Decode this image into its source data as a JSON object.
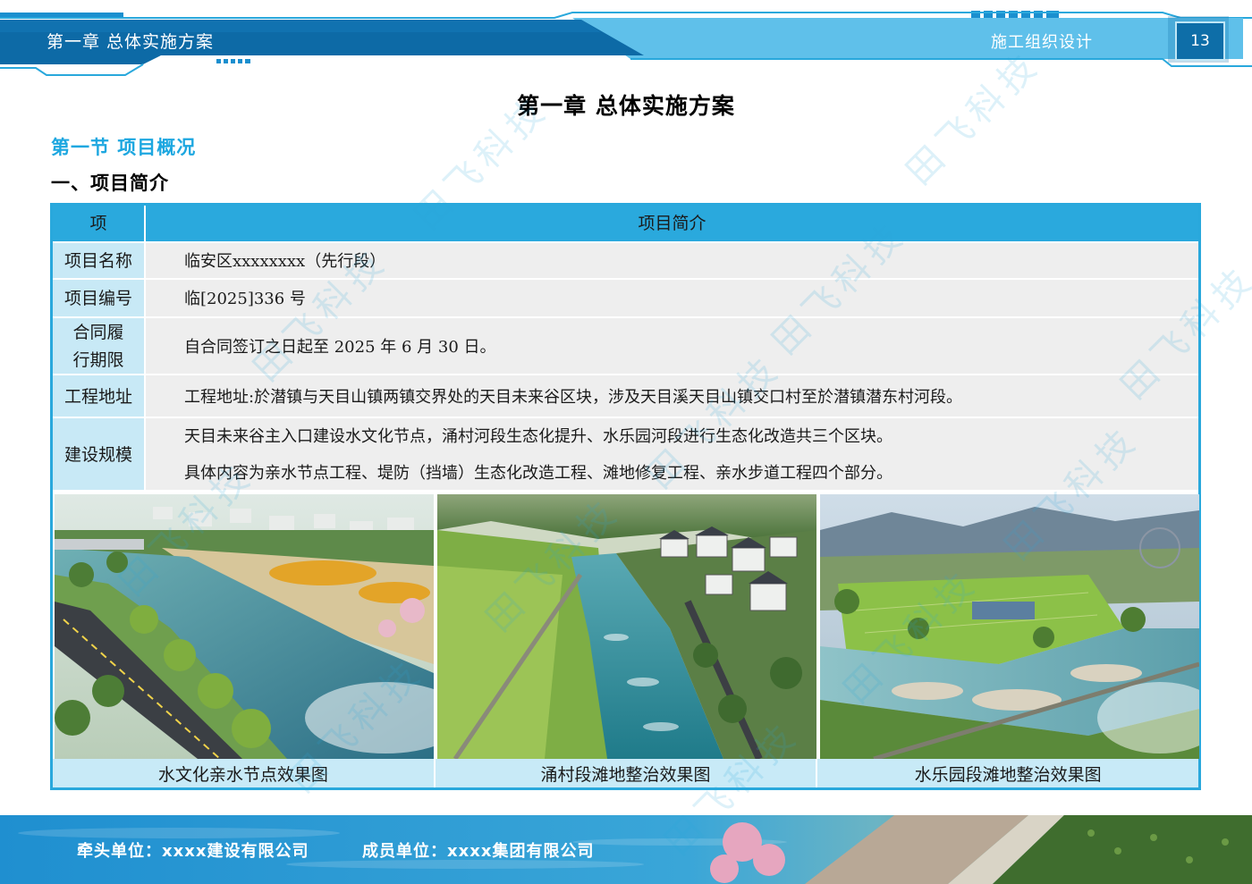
{
  "header": {
    "chapter_label": "第一章  总体实施方案",
    "doc_label": "施工组织设计",
    "page_number": "13"
  },
  "content": {
    "chapter_title": "第一章  总体实施方案",
    "section_title": "第一节  项目概况",
    "subsection_title": "一、项目简介"
  },
  "table": {
    "head_key": "项",
    "head_value": "项目简介",
    "rows": [
      {
        "key": "项目名称",
        "value": "临安区xxxxxxxx（先行段）"
      },
      {
        "key": "项目编号",
        "value": "临[2025]336 号"
      },
      {
        "key": "合同履行期限",
        "value": "自合同签订之日起至 2025 年 6 月 30 日。"
      },
      {
        "key": "工程地址",
        "value": "工程地址:於潜镇与天目山镇两镇交界处的天目未来谷区块，涉及天目溪天目山镇交口村至於潜镇潜东村河段。"
      },
      {
        "key": "建设规模",
        "value_lines": [
          "天目未来谷主入口建设水文化节点，涌村河段生态化提升、水乐园河段进行生态化改造共三个区块。",
          "具体内容为亲水节点工程、堤防（挡墙）生态化改造工程、滩地修复工程、亲水步道工程四个部分。"
        ]
      }
    ],
    "captions": [
      "水文化亲水节点效果图",
      "涌村段滩地整治效果图",
      "水乐园段滩地整治效果图"
    ]
  },
  "footer": {
    "lead_unit": "牵头单位：xxxx建设有限公司",
    "member_unit": "成员单位：xxxx集团有限公司"
  },
  "watermark": "田飞科技",
  "colors": {
    "accent": "#29a8dc",
    "header_dark": "#0e6ea8",
    "key_cell": "#c8e9f6"
  }
}
